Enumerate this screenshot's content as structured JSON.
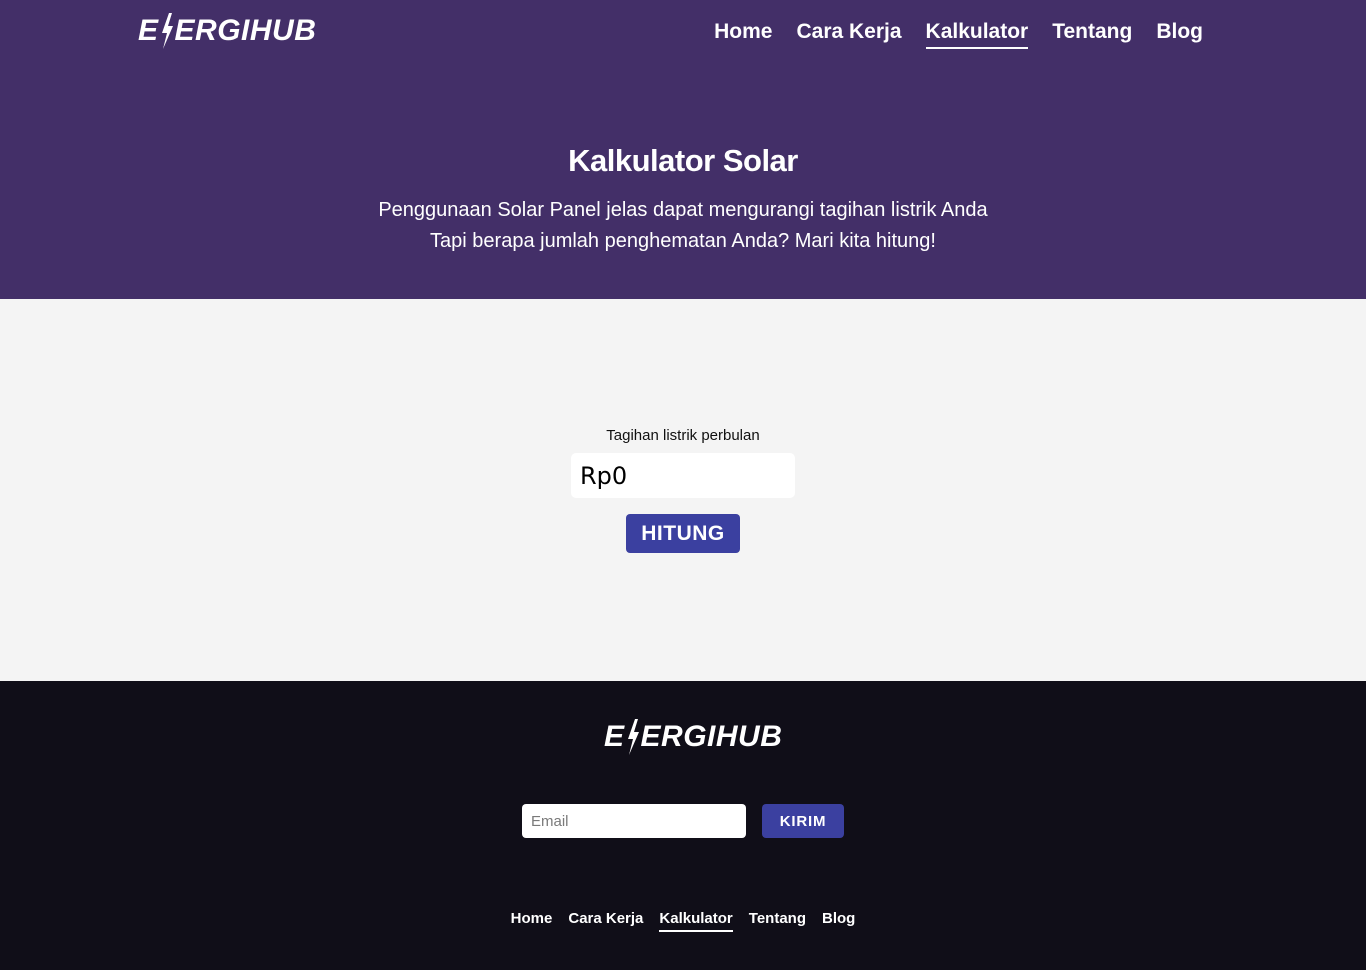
{
  "brand": {
    "logo_start": "E",
    "logo_end": "ERGIHUB",
    "logo_icon": "lightning-bolt-icon"
  },
  "nav": {
    "items": [
      {
        "label": "Home"
      },
      {
        "label": "Cara Kerja"
      },
      {
        "label": "Kalkulator"
      },
      {
        "label": "Tentang"
      },
      {
        "label": "Blog"
      }
    ]
  },
  "hero": {
    "title": "Kalkulator Solar",
    "subtitle_line1": "Penggunaan Solar Panel jelas dapat mengurangi tagihan listrik Anda",
    "subtitle_line2": "Tapi berapa jumlah penghematan Anda? Mari kita hitung!"
  },
  "calculator": {
    "label": "Tagihan listrik perbulan",
    "value": "Rp0",
    "button_label": "HITUNG"
  },
  "footer": {
    "email_placeholder": "Email",
    "send_label": "KIRIM",
    "nav": [
      {
        "label": "Home"
      },
      {
        "label": "Cara Kerja"
      },
      {
        "label": "Kalkulator"
      },
      {
        "label": "Tentang"
      },
      {
        "label": "Blog"
      }
    ]
  },
  "colors": {
    "header_bg": "#432f68",
    "body_bg": "#f4f4f4",
    "footer_bg": "#100e18",
    "accent": "#3b40a0"
  }
}
